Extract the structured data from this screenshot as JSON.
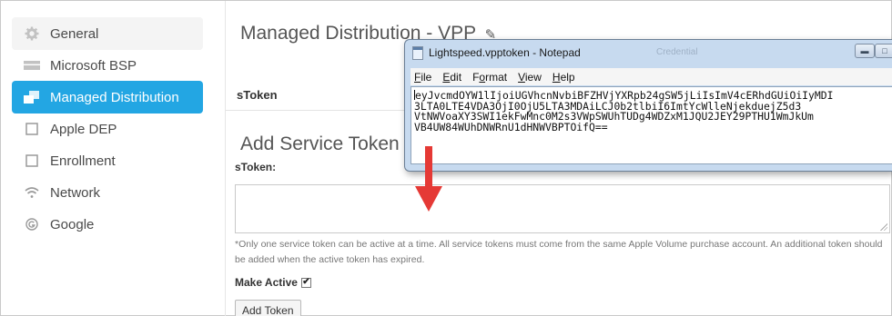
{
  "sidebar": {
    "items": [
      {
        "label": "General",
        "icon": "gear-icon"
      },
      {
        "label": "Microsoft BSP",
        "icon": "windows-icon"
      },
      {
        "label": "Managed Distribution",
        "icon": "app-store-icon"
      },
      {
        "label": "Apple DEP",
        "icon": "square-icon"
      },
      {
        "label": "Enrollment",
        "icon": "square-icon"
      },
      {
        "label": "Network",
        "icon": "wifi-icon"
      },
      {
        "label": "Google",
        "icon": "google-icon"
      }
    ],
    "active_index": 2
  },
  "main": {
    "title": "Managed Distribution - VPP",
    "stoken_row_label": "sToken",
    "section_title": "Add Service Token",
    "stoken_field_label": "sToken:",
    "stoken_value": "",
    "help_text": "*Only one service token can be active at a time. All service tokens must come from the same Apple Volume purchase account. An additional token should be added when the active token has expired.",
    "make_active_label": "Make Active",
    "make_active_checked": true,
    "add_button_label": "Add Token"
  },
  "notepad": {
    "title": "Lightspeed.vpptoken - Notepad",
    "ghost_title": "Credential",
    "menu": [
      "File",
      "Edit",
      "Format",
      "View",
      "Help"
    ],
    "lines": [
      "eyJvcmdOYW1lIjoiUGVhcnNvbiBFZHVjYXRpb24gSW5jLiIsImV4cERhdGUiOiIyMDI",
      "3LTA0LTE4VDA3OjI0OjU5LTA3MDAiLCJ0b2tlbiI6ImtYcWlleNjekduejZ5d3",
      "VtNWVoaXY3SWI1ekFwMnc0M2s3VWpSWUhTUDg4WDZxM1JQU2JEY29PTHU1WmJkUm",
      "VB4UW84WUhDNWRnU1dHNWVBPTOifQ=="
    ]
  },
  "colors": {
    "accent": "#23a6e3",
    "arrow": "#e53935"
  }
}
